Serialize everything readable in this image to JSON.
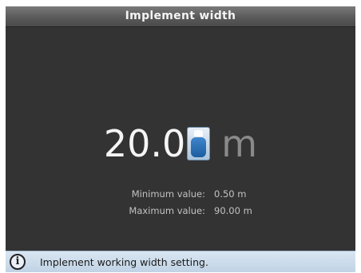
{
  "title": "Implement width",
  "value": {
    "digits_main": "20.0",
    "digit_editing": "0",
    "unit": "m"
  },
  "limits": {
    "min_label": "Minimum value:",
    "min_value": "0.50 m",
    "max_label": "Maximum value:",
    "max_value": "90.00 m"
  },
  "status": {
    "icon": "info-icon",
    "text": "Implement working width setting."
  },
  "colors": {
    "background": "#333333",
    "titlebar": "#5a5a5a",
    "statusbar": "#c9d9e8",
    "cursor_accent": "#1f5fa0"
  }
}
